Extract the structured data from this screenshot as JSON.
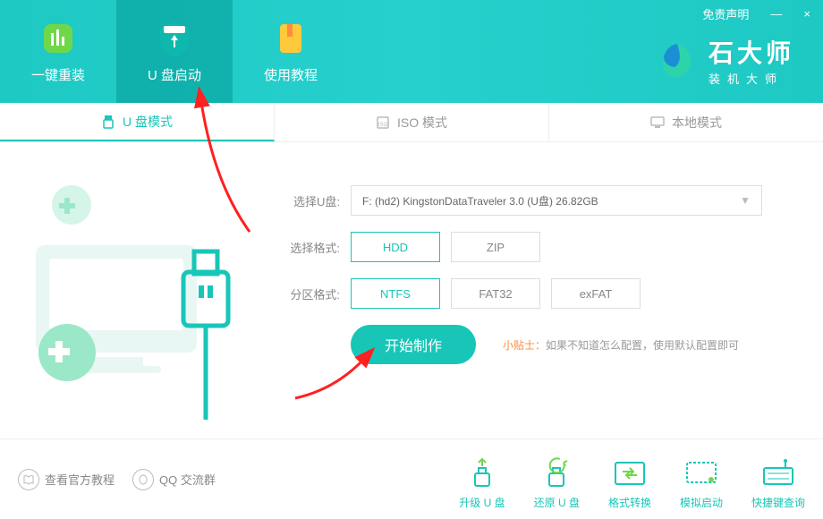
{
  "titlebar": {
    "disclaimer": "免责声明",
    "minimize": "—",
    "close": "×"
  },
  "logo": {
    "title": "石大师",
    "subtitle": "装机大师"
  },
  "nav": {
    "tabs": [
      {
        "label": "一键重装"
      },
      {
        "label": "U 盘启动"
      },
      {
        "label": "使用教程"
      }
    ]
  },
  "modes": {
    "tabs": [
      {
        "label": "U 盘模式"
      },
      {
        "label": "ISO 模式"
      },
      {
        "label": "本地模式"
      }
    ]
  },
  "form": {
    "disk_label": "选择U盘:",
    "disk_value": "F: (hd2) KingstonDataTraveler 3.0 (U盘) 26.82GB",
    "format_label": "选择格式:",
    "format_options": [
      "HDD",
      "ZIP"
    ],
    "format_selected": "HDD",
    "partition_label": "分区格式:",
    "partition_options": [
      "NTFS",
      "FAT32",
      "exFAT"
    ],
    "partition_selected": "NTFS"
  },
  "action": {
    "start": "开始制作",
    "tip_label": "小贴士：",
    "tip_text": "如果不知道怎么配置，使用默认配置即可"
  },
  "bottom_left": {
    "tutorial": "查看官方教程",
    "qq": "QQ 交流群"
  },
  "tools": [
    {
      "label": "升级 U 盘"
    },
    {
      "label": "还原 U 盘"
    },
    {
      "label": "格式转换"
    },
    {
      "label": "模拟启动"
    },
    {
      "label": "快捷键查询"
    }
  ]
}
